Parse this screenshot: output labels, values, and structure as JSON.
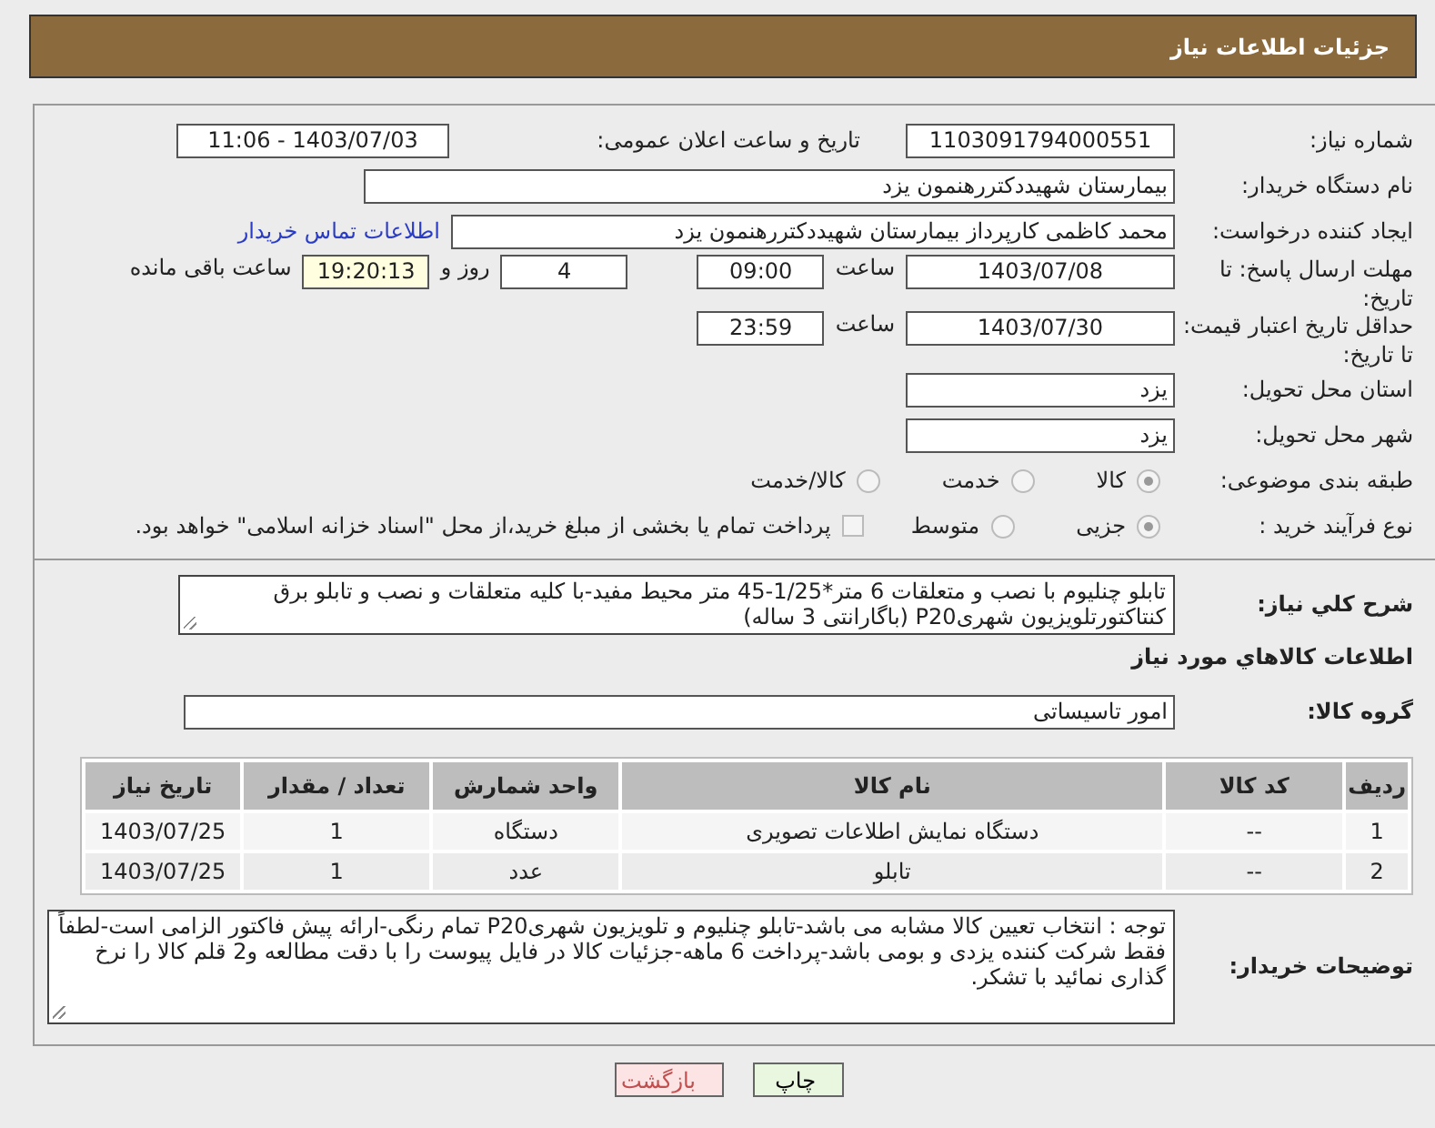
{
  "header": {
    "title": "جزئیات اطلاعات نیاز"
  },
  "need_number": {
    "label": "شماره نیاز:",
    "value": "1103091794000551"
  },
  "announce": {
    "label": "تاریخ و ساعت اعلان عمومی:",
    "value": "1403/07/03 - 11:06"
  },
  "buyer": {
    "label": "نام دستگاه خریدار:",
    "value": "بیمارستان شهیددکتررهنمون یزد"
  },
  "creator": {
    "label": "ایجاد کننده درخواست:",
    "value": "محمد کاظمی کارپرداز بیمارستان شهیددکتررهنمون یزد",
    "link": "اطلاعات تماس خریدار"
  },
  "deadline": {
    "label": "مهلت ارسال پاسخ: تا تاریخ:",
    "date": "1403/07/08",
    "time_label": "ساعت",
    "time": "09:00",
    "days": "4",
    "days_label": "روز و",
    "remaining": "19:20:13",
    "remaining_label": "ساعت باقی مانده"
  },
  "validity": {
    "label": "حداقل تاریخ اعتبار قیمت: تا تاریخ:",
    "date": "1403/07/30",
    "time_label": "ساعت",
    "time": "23:59"
  },
  "province": {
    "label": "استان محل تحویل:",
    "value": "یزد"
  },
  "city": {
    "label": "شهر محل تحویل:",
    "value": "یزد"
  },
  "category": {
    "label": "طبقه بندی موضوعی:",
    "options": [
      {
        "label": "کالا",
        "selected": true
      },
      {
        "label": "خدمت",
        "selected": false
      },
      {
        "label": "کالا/خدمت",
        "selected": false
      }
    ]
  },
  "process": {
    "label": "نوع فرآیند خرید :",
    "options": [
      {
        "label": "جزیی",
        "selected": true
      },
      {
        "label": "متوسط",
        "selected": false
      }
    ],
    "payment": {
      "label": "پرداخت تمام یا بخشی از مبلغ خرید،از محل \"اسناد خزانه اسلامی\" خواهد بود.",
      "checked": false
    }
  },
  "description": {
    "label": "شرح کلي نياز:",
    "value": "تابلو چنلیوم با نصب و متعلقات 6 متر*1/25-45 متر محیط مفید-با کلیه متعلقات و نصب و تابلو برق کنتاکتورتلویزیون شهریP20 (باگارانتی 3 ساله)"
  },
  "goods_title": "اطلاعات کالاهاي مورد نياز",
  "goods_group": {
    "label": "گروه کالا:",
    "value": "امور تاسیساتی"
  },
  "table": {
    "columns": [
      "ردیف",
      "کد کالا",
      "نام کالا",
      "واحد شمارش",
      "تعداد / مقدار",
      "تاریخ نیاز"
    ],
    "rows": [
      [
        "1",
        "--",
        "دستگاه نمایش اطلاعات تصویری",
        "دستگاه",
        "1",
        "1403/07/25"
      ],
      [
        "2",
        "--",
        "تابلو",
        "عدد",
        "1",
        "1403/07/25"
      ]
    ]
  },
  "notes": {
    "label": "توضیحات خریدار:",
    "value": "توجه : انتخاب تعیین کالا مشابه می باشد-تابلو چنلیوم و تلویزیون شهریP20 تمام رنگی-ارائه پیش فاکتور الزامی است-لطفاً فقط شرکت کننده یزدی و بومی باشد-پرداخت 6 ماهه-جزئیات کالا در فایل پیوست را با دقت مطالعه و2 قلم کالا را نرخ گذاری نمائید با تشکر."
  },
  "buttons": [
    {
      "label": "چاپ",
      "kind": "print"
    },
    {
      "label": "بازگشت",
      "kind": "back"
    }
  ]
}
